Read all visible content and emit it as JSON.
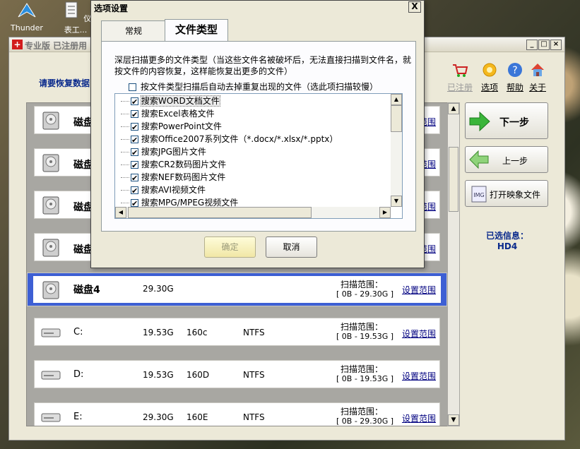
{
  "desktop": {
    "icons": [
      {
        "label": "Thunder"
      },
      {
        "label": "仪表工..."
      }
    ]
  },
  "main_window": {
    "title": "专业版  已注册用",
    "prompt": "请要恢复数据",
    "top_toolbar": [
      {
        "label": "已注册",
        "icon": "cart-icon",
        "dimmed": true
      },
      {
        "label": "选项",
        "icon": "gear-icon"
      },
      {
        "label": "帮助",
        "icon": "help-icon"
      },
      {
        "label": "关于",
        "icon": "home-icon"
      }
    ],
    "disks": [
      {
        "name": "磁盘",
        "size": "",
        "sectors": "",
        "fs": "",
        "range_label": "",
        "range": "",
        "link": "范围",
        "selected": false
      },
      {
        "name": "磁盘",
        "size": "",
        "sectors": "",
        "fs": "",
        "range_label": "",
        "range": "",
        "link": "范围",
        "selected": false
      },
      {
        "name": "磁盘",
        "size": "",
        "sectors": "",
        "fs": "",
        "range_label": "",
        "range": "",
        "link": "范围",
        "selected": false
      },
      {
        "name": "磁盘",
        "size": "",
        "sectors": "",
        "fs": "",
        "range_label": "",
        "range": "",
        "link": "范围",
        "selected": false
      },
      {
        "name": "磁盘4",
        "size": "29.30G",
        "sectors": "",
        "fs": "",
        "range_label": "扫描范围：",
        "range": "[ 0B - 29.30G ]",
        "link": "设置范围",
        "selected": true
      },
      {
        "name": "C:",
        "size": "19.53G",
        "sectors": "160c",
        "fs": "NTFS",
        "range_label": "扫描范围：",
        "range": "[ 0B - 19.53G ]",
        "link": "设置范围",
        "selected": false
      },
      {
        "name": "D:",
        "size": "19.53G",
        "sectors": "160D",
        "fs": "NTFS",
        "range_label": "扫描范围：",
        "range": "[ 0B - 19.53G ]",
        "link": "设置范围",
        "selected": false
      },
      {
        "name": "E:",
        "size": "29.30G",
        "sectors": "160E",
        "fs": "NTFS",
        "range_label": "扫描范围：",
        "range": "[ 0B - 29.30G ]",
        "link": "设置范围",
        "selected": false
      }
    ],
    "buttons": {
      "next": "下一步",
      "prev": "上一步",
      "open_image": "打开映象文件"
    },
    "selected_info_label": "已选信息：",
    "selected_info_value": "HD4"
  },
  "dialog": {
    "title": "选项设置",
    "close": "X",
    "tabs": [
      {
        "label": "常规",
        "active": false
      },
      {
        "label": "文件类型",
        "active": true
      }
    ],
    "description": "深层扫描更多的文件类型（当这些文件名被破坏后，无法直接扫描到文件名，就按文件的内容恢复，这样能恢复出更多的文件）",
    "dedup_label": "按文件类型扫描后自动去掉重复出现的文件（选此项扫描较慢）",
    "dedup_checked": false,
    "file_types": [
      {
        "label": "搜索WORD文档文件",
        "checked": true
      },
      {
        "label": "搜索Excel表格文件",
        "checked": true
      },
      {
        "label": "搜索PowerPoint文件",
        "checked": true
      },
      {
        "label": "搜索Office2007系列文件（*.docx/*.xlsx/*.pptx）",
        "checked": true
      },
      {
        "label": "搜索JPG图片文件",
        "checked": true
      },
      {
        "label": "搜索CR2数码图片文件",
        "checked": true
      },
      {
        "label": "搜索NEF数码图片文件",
        "checked": true
      },
      {
        "label": "搜索AVI视频文件",
        "checked": true
      },
      {
        "label": "搜索MPG/MPEG视频文件",
        "checked": true
      }
    ],
    "ok": "确定",
    "cancel": "取消"
  },
  "colors": {
    "selection_blue": "#3d5fd4",
    "title_blue": "#0a2a8c",
    "next_arrow": "#3ab53a"
  }
}
